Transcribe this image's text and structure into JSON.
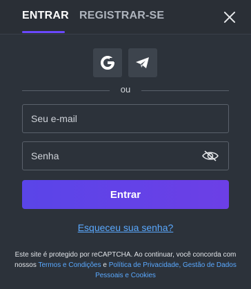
{
  "tabs": {
    "login_label": "ENTRAR",
    "register_label": "REGISTRAR-SE"
  },
  "close": {
    "icon": "close-icon"
  },
  "social": {
    "google_icon": "google-icon",
    "telegram_icon": "telegram-icon"
  },
  "divider": {
    "text": "ou"
  },
  "form": {
    "email_placeholder": "Seu e-mail",
    "email_value": "",
    "password_placeholder": "Senha",
    "password_value": "",
    "eye_icon": "eye-icon",
    "submit_label": "Entrar"
  },
  "forgot_password": "Esqueceu sua senha?",
  "legal": {
    "line1": "Este site é protegido por reCAPTCHA. Ao continuar, você concorda com nossos",
    "terms_link": "Termos e Condições",
    "and": "e",
    "privacy_link": "Política de Privacidade, Gestão de Dados Pessoais e Cookies"
  },
  "colors": {
    "background": "#2c323a",
    "accent": "#6a48ff",
    "link": "#5aa9ff"
  }
}
